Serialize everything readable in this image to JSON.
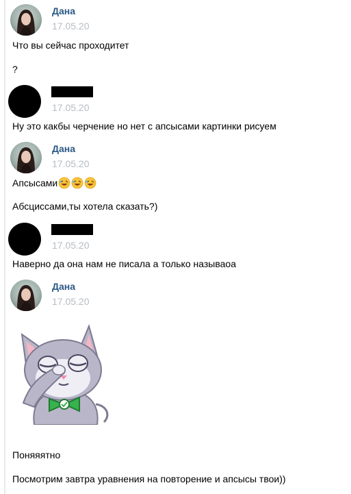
{
  "messages": [
    {
      "author": "Дана",
      "date": "17.05.20",
      "lines": [
        "Что вы сейчас проходитет",
        "?"
      ]
    },
    {
      "author": "",
      "date": "17.05.20",
      "lines": [
        "Ну это какбы черчение но нет с апсысами картинки рисуем"
      ]
    },
    {
      "author": "Дана",
      "date": "17.05.20",
      "lines": [
        "Апсысами",
        "Абсциссами,ты хотела сказать?)"
      ],
      "emoji": [
        "rofl-emoji",
        "rofl-emoji",
        "rofl-emoji"
      ]
    },
    {
      "author": "",
      "date": "17.05.20",
      "lines": [
        "Наверно да она нам не писала а только называоа"
      ]
    },
    {
      "author": "Дана",
      "date": "17.05.20",
      "sticker": "facepalm-cat-sticker",
      "lines": [
        "Поняяятно",
        "Посмотрим завтра уравнения на повторение и апсысы твои))"
      ]
    }
  ],
  "colors": {
    "author": "#2a5885",
    "date": "#b7bcc2",
    "rule": "#e7e8ec"
  }
}
